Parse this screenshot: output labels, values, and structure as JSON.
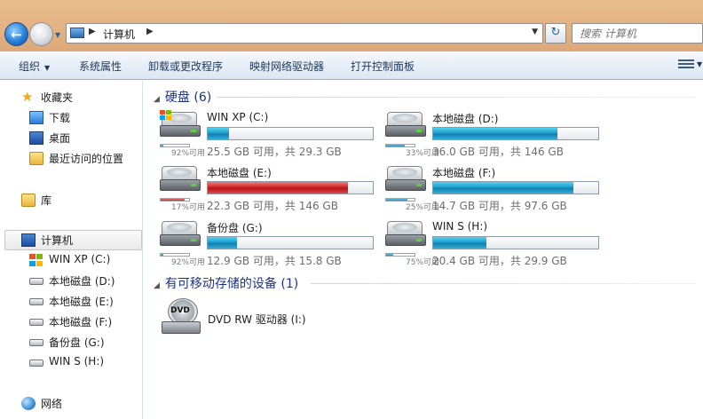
{
  "address": {
    "crumb": "计算机",
    "search_placeholder": "搜索 计算机"
  },
  "toolbar": {
    "organize": "组织",
    "system_properties": "系统属性",
    "uninstall": "卸载或更改程序",
    "map_drive": "映射网络驱动器",
    "control_panel": "打开控制面板"
  },
  "nav": {
    "favorites": "收藏夹",
    "downloads": "下载",
    "desktop": "桌面",
    "recent": "最近访问的位置",
    "libraries": "库",
    "computer": "计算机",
    "drives": [
      {
        "label": "WIN XP (C:)",
        "icon": "windows-drive-icon"
      },
      {
        "label": "本地磁盘 (D:)",
        "icon": "drive-icon"
      },
      {
        "label": "本地磁盘 (E:)",
        "icon": "drive-icon"
      },
      {
        "label": "本地磁盘 (F:)",
        "icon": "drive-icon"
      },
      {
        "label": "备份盘 (G:)",
        "icon": "drive-icon"
      },
      {
        "label": "WIN S (H:)",
        "icon": "drive-icon"
      }
    ],
    "network": "网络"
  },
  "content": {
    "hdd_group": "硬盘 (6)",
    "removable_group": "有可移动存储的设备 (1)",
    "drives": [
      {
        "name": "WIN XP (C:)",
        "free": "25.5 GB 可用，共 29.3 GB",
        "used_fraction": 0.13,
        "mini": "92%可用",
        "warning": false,
        "system": true
      },
      {
        "name": "本地磁盘 (D:)",
        "free": "36.0 GB 可用，共 146 GB",
        "used_fraction": 0.75,
        "mini": "33%可用",
        "warning": false,
        "system": false
      },
      {
        "name": "本地磁盘 (E:)",
        "free": "22.3 GB 可用，共 146 GB",
        "used_fraction": 0.85,
        "mini": "17%可用",
        "warning": true,
        "system": false
      },
      {
        "name": "本地磁盘 (F:)",
        "free": "14.7 GB 可用，共 97.6 GB",
        "used_fraction": 0.85,
        "mini": "25%可用",
        "warning": false,
        "system": false
      },
      {
        "name": "备份盘 (G:)",
        "free": "12.9 GB 可用，共 15.8 GB",
        "used_fraction": 0.18,
        "mini": "92%可用",
        "warning": false,
        "system": false
      },
      {
        "name": "WIN S (H:)",
        "free": "20.4 GB 可用，共 29.9 GB",
        "used_fraction": 0.32,
        "mini": "75%可用",
        "warning": false,
        "system": false
      }
    ],
    "dvd": {
      "name": "DVD RW 驱动器 (I:)",
      "disc_label": "DVD"
    }
  },
  "colors": {
    "bar_normal": "#1e9dcc",
    "bar_warning": "#d0282a",
    "group_heading": "#1e3287"
  }
}
